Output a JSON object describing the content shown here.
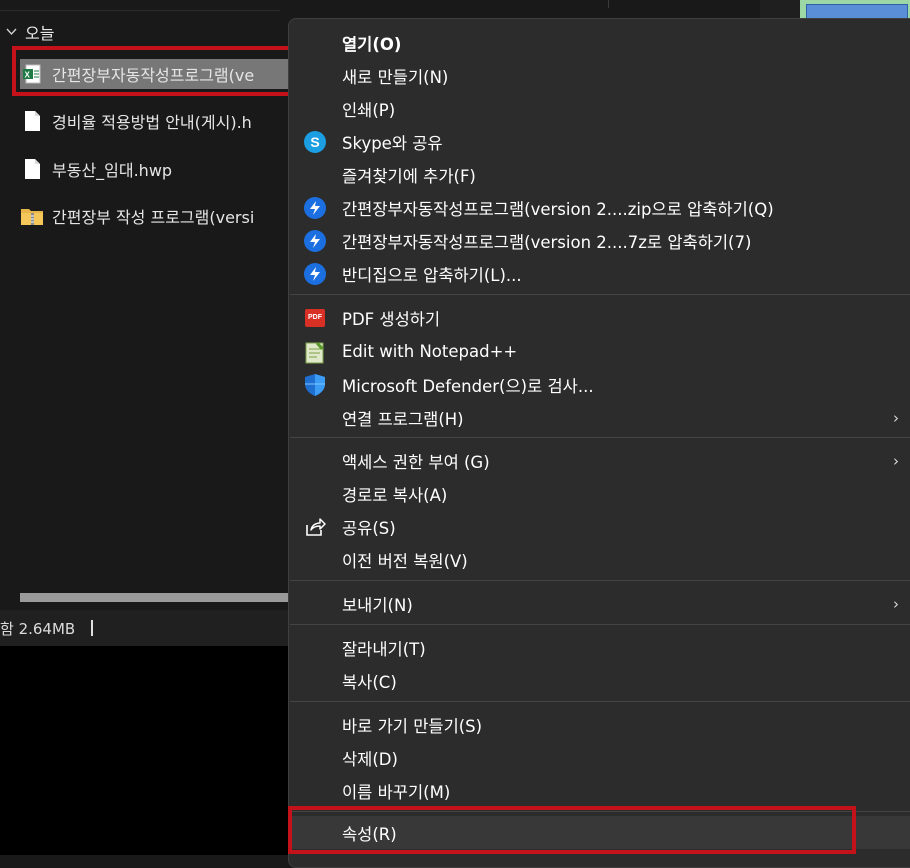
{
  "explorer": {
    "group_header": "오늘",
    "files": [
      {
        "name": "간편장부자동작성프로그램(ve",
        "icon": "excel-file-icon",
        "selected": true
      },
      {
        "name": "경비율 적용방법 안내(게시).h",
        "icon": "document-file-icon",
        "selected": false
      },
      {
        "name": "부동산_임대.hwp",
        "icon": "document-file-icon",
        "selected": false
      },
      {
        "name": "간편장부 작성 프로그램(versi",
        "icon": "zip-folder-icon",
        "selected": false
      }
    ],
    "status_text": "함 2.64MB"
  },
  "context_menu": {
    "items": [
      {
        "label": "열기(O)",
        "bold": true
      },
      {
        "label": "새로 만들기(N)"
      },
      {
        "label": "인쇄(P)"
      },
      {
        "label": "Skype와 공유",
        "icon": "skype-icon"
      },
      {
        "label": "즐겨찾기에 추가(F)"
      },
      {
        "label": "간편장부자동작성프로그램(version 2....zip으로 압축하기(Q)",
        "icon": "bandizip-icon"
      },
      {
        "label": "간편장부자동작성프로그램(version 2....7z로 압축하기(7)",
        "icon": "bandizip-icon"
      },
      {
        "label": "반디집으로 압축하기(L)...",
        "icon": "bandizip-icon"
      },
      {
        "label": "PDF 생성하기",
        "icon": "pdf-icon"
      },
      {
        "label": "Edit with Notepad++",
        "icon": "notepadpp-icon"
      },
      {
        "label": "Microsoft Defender(으)로 검사...",
        "icon": "defender-shield-icon"
      },
      {
        "label": "연결 프로그램(H)",
        "submenu": true
      },
      {
        "label": "액세스 권한 부여 (G)",
        "submenu": true
      },
      {
        "label": "경로로 복사(A)"
      },
      {
        "label": "공유(S)",
        "icon": "share-icon"
      },
      {
        "label": "이전 버전 복원(V)"
      },
      {
        "label": "보내기(N)",
        "submenu": true
      },
      {
        "label": "잘라내기(T)"
      },
      {
        "label": "복사(C)"
      },
      {
        "label": "바로 가기 만들기(S)"
      },
      {
        "label": "삭제(D)"
      },
      {
        "label": "이름 바꾸기(M)"
      },
      {
        "label": "속성(R)",
        "highlighted": true
      }
    ],
    "pdf_icon_text": "PDF",
    "skype_icon_text": "S",
    "submenu_arrow": "›"
  },
  "colors": {
    "highlight_outline": "#c4121b",
    "menu_bg": "#2c2c2c",
    "bandizip_blue": "#1c6fe0"
  }
}
